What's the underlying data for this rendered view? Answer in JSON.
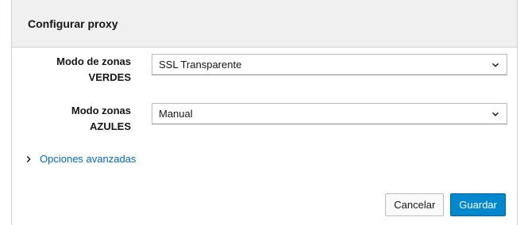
{
  "dialog": {
    "title": "Configurar proxy"
  },
  "fields": {
    "green": {
      "label_line1": "Modo de zonas",
      "label_line2": "VERDES",
      "value": "SSL Transparente"
    },
    "blue": {
      "label_line1": "Modo zonas",
      "label_line2": "AZULES",
      "value": "Manual"
    }
  },
  "advanced": {
    "label": "Opciones avanzadas",
    "icon": "chevron-right-icon"
  },
  "footer": {
    "cancel_label": "Cancelar",
    "save_label": "Guardar"
  },
  "colors": {
    "primary": "#0088ce",
    "link": "#0066cc",
    "header_bg": "#f0f0f0"
  }
}
